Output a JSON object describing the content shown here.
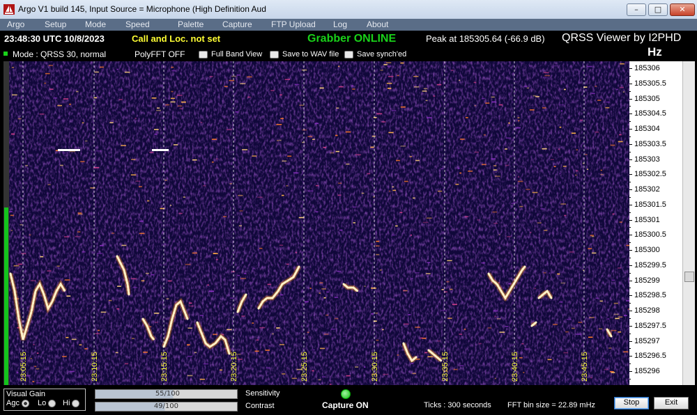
{
  "window": {
    "title": "Argo V1 build 145, Input Source = Microphone (High Definition Aud"
  },
  "menu": [
    "Argo",
    "Setup",
    "Mode",
    "Speed",
    "Palette",
    "Capture",
    "FTP Upload",
    "Log",
    "About"
  ],
  "status": {
    "time": "23:48:30 UTC  10/8/2023",
    "callsign": "Call and Loc. not set",
    "grabber": "Grabber ONLINE",
    "peak": "Peak at  185305.64 (-66.9 dB)",
    "viewer": "QRSS Viewer by I2PHD",
    "unit": "Hz"
  },
  "options": {
    "mode": "Mode : QRSS 30, normal",
    "polyfft": "PolyFFT OFF",
    "full_band": "Full Band View",
    "save_wav": "Save to WAV file",
    "save_synched": "Save synch'ed"
  },
  "freq_scale": [
    "185306",
    "185305.5",
    "185305",
    "185304.5",
    "185304",
    "185303.5",
    "185303",
    "185302.5",
    "185302",
    "185301.5",
    "185301",
    "185300.5",
    "185300",
    "185299.5",
    "185299",
    "185298.5",
    "185298",
    "185297.5",
    "185297",
    "185296.5",
    "185296"
  ],
  "time_marks": [
    "23:05:15",
    "23:10:15",
    "23:15:15",
    "23:20:15",
    "23:25:15",
    "23:30:15",
    "23:35:15",
    "23:40:15",
    "23:45:15"
  ],
  "bottom": {
    "visual_gain": "Visual Gain",
    "agc": "Agc",
    "lo": "Lo",
    "hi": "Hi",
    "sensitivity_value": "55/100",
    "sensitivity_label": "Sensitivity",
    "contrast_value": "49/100",
    "contrast_label": "Contrast",
    "capture": "Capture ON",
    "ticks": "Ticks   : 300 seconds",
    "fft": "FFT bin size = 22.89 mHz",
    "stop": "Stop",
    "exit": "Exit"
  },
  "levels": {
    "sensitivity": 0.55,
    "contrast": 0.49
  },
  "colors": {
    "grabber": "#19d119",
    "callsign": "#ffff33",
    "signal": "#fff2c8",
    "background": "#10083a"
  }
}
